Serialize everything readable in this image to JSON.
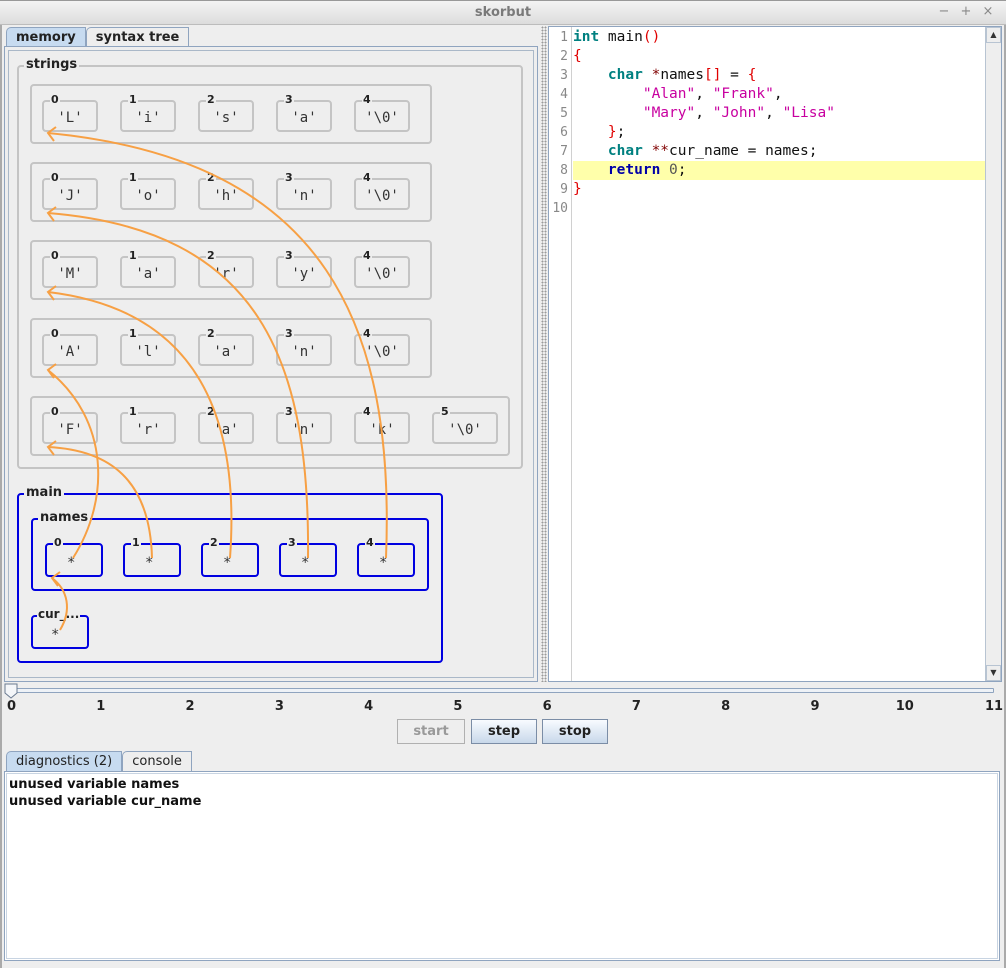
{
  "window": {
    "title": "skorbut",
    "controls": {
      "minimize": "−",
      "maximize": "+",
      "close": "×"
    }
  },
  "left_tabs": [
    {
      "label": "memory",
      "active": true
    },
    {
      "label": "syntax tree",
      "active": false
    }
  ],
  "memory": {
    "strings_label": "strings",
    "strings": [
      {
        "chars": [
          "'L'",
          "'i'",
          "'s'",
          "'a'",
          "'\\0'"
        ]
      },
      {
        "chars": [
          "'J'",
          "'o'",
          "'h'",
          "'n'",
          "'\\0'"
        ]
      },
      {
        "chars": [
          "'M'",
          "'a'",
          "'r'",
          "'y'",
          "'\\0'"
        ]
      },
      {
        "chars": [
          "'A'",
          "'l'",
          "'a'",
          "'n'",
          "'\\0'"
        ]
      },
      {
        "chars": [
          "'F'",
          "'r'",
          "'a'",
          "'n'",
          "'k'",
          "'\\0'"
        ]
      }
    ],
    "indices": [
      "0",
      "1",
      "2",
      "3",
      "4",
      "5"
    ],
    "main_label": "main",
    "names_label": "names",
    "names_cells": [
      "*",
      "*",
      "*",
      "*",
      "*"
    ],
    "cur_label": "cur_...",
    "cur_value": "*",
    "pointer_targets": {
      "names.0": "strings.3",
      "names.1": "strings.4",
      "names.2": "strings.2",
      "names.3": "strings.1",
      "names.4": "strings.0",
      "cur_name": "names.0"
    },
    "colors": {
      "arrow": "#f7a044",
      "stack_frame": "#0000e0",
      "heap": "#c4c4c4"
    }
  },
  "editor": {
    "line_numbers": [
      "1",
      "2",
      "3",
      "4",
      "5",
      "6",
      "7",
      "8",
      "9",
      "10"
    ],
    "highlighted_line": 8,
    "lines": [
      [
        {
          "t": "int",
          "c": "kw"
        },
        {
          "t": " main",
          "c": "plain"
        },
        {
          "t": "()",
          "c": "pun"
        }
      ],
      [
        {
          "t": "{",
          "c": "pun"
        }
      ],
      [
        {
          "t": "    ",
          "c": "plain"
        },
        {
          "t": "char",
          "c": "kw"
        },
        {
          "t": " ",
          "c": "plain"
        },
        {
          "t": "*",
          "c": "op"
        },
        {
          "t": "names",
          "c": "plain"
        },
        {
          "t": "[]",
          "c": "pun"
        },
        {
          "t": " = ",
          "c": "plain"
        },
        {
          "t": "{",
          "c": "pun"
        }
      ],
      [
        {
          "t": "        ",
          "c": "plain"
        },
        {
          "t": "\"Alan\"",
          "c": "str"
        },
        {
          "t": ", ",
          "c": "plain"
        },
        {
          "t": "\"Frank\"",
          "c": "str"
        },
        {
          "t": ",",
          "c": "plain"
        }
      ],
      [
        {
          "t": "        ",
          "c": "plain"
        },
        {
          "t": "\"Mary\"",
          "c": "str"
        },
        {
          "t": ", ",
          "c": "plain"
        },
        {
          "t": "\"John\"",
          "c": "str"
        },
        {
          "t": ", ",
          "c": "plain"
        },
        {
          "t": "\"Lisa\"",
          "c": "str"
        }
      ],
      [
        {
          "t": "    ",
          "c": "plain"
        },
        {
          "t": "}",
          "c": "pun"
        },
        {
          "t": ";",
          "c": "plain"
        }
      ],
      [
        {
          "t": "    ",
          "c": "plain"
        },
        {
          "t": "char",
          "c": "kw"
        },
        {
          "t": " ",
          "c": "plain"
        },
        {
          "t": "**",
          "c": "op"
        },
        {
          "t": "cur_name = names;",
          "c": "plain"
        }
      ],
      [
        {
          "t": "    ",
          "c": "plain"
        },
        {
          "t": "return",
          "c": "kw2"
        },
        {
          "t": " ",
          "c": "plain"
        },
        {
          "t": "0",
          "c": "num"
        },
        {
          "t": ";",
          "c": "plain"
        }
      ],
      [
        {
          "t": "}",
          "c": "pun"
        }
      ],
      []
    ]
  },
  "timeline": {
    "ticks": [
      "0",
      "1",
      "2",
      "3",
      "4",
      "5",
      "6",
      "7",
      "8",
      "9",
      "10",
      "11"
    ],
    "value": 0,
    "min": 0,
    "max": 11
  },
  "controls": {
    "start": {
      "label": "start",
      "enabled": false
    },
    "step": {
      "label": "step",
      "enabled": true
    },
    "stop": {
      "label": "stop",
      "enabled": true
    }
  },
  "bottom_tabs": [
    {
      "label": "diagnostics (2)",
      "active": true
    },
    {
      "label": "console",
      "active": false
    }
  ],
  "diagnostics": [
    "unused variable names",
    "unused variable cur_name"
  ]
}
